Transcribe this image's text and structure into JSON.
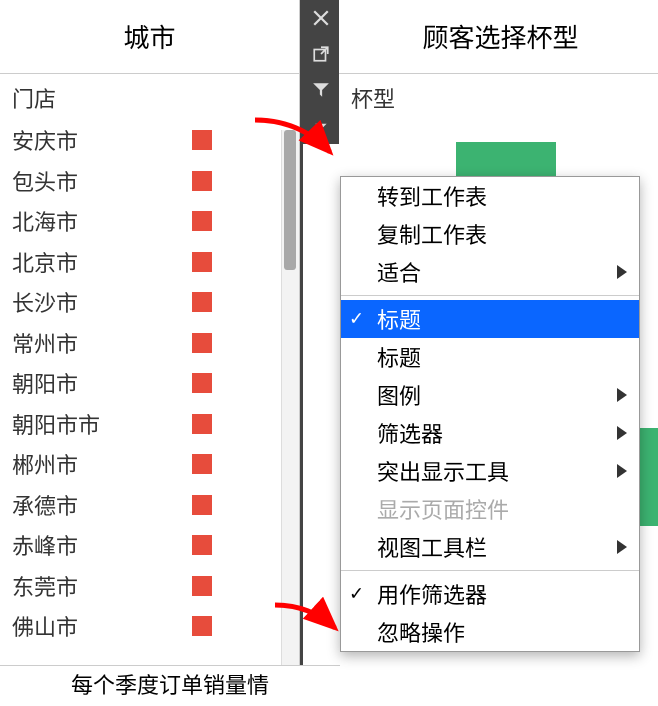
{
  "left": {
    "title": "城市",
    "store_label": "门店",
    "cities": [
      "安庆市",
      "包头市",
      "北海市",
      "北京市",
      "长沙市",
      "常州市",
      "朝阳市",
      "朝阳市市",
      "郴州市",
      "承德市",
      "赤峰市",
      "东莞市",
      "佛山市"
    ],
    "swatch_color": "#e74c3c"
  },
  "toolbar": {
    "close": "close",
    "popout": "popout",
    "filter": "filter",
    "dropdown": "dropdown"
  },
  "right": {
    "title": "顾客选择杯型",
    "sublabel": "杯型"
  },
  "footer": "每个季度订单销量情",
  "menu": {
    "goto_sheet": "转到工作表",
    "copy_sheet": "复制工作表",
    "fit": "适合",
    "title_checked": "标题",
    "title2": "标题",
    "legend": "图例",
    "filters": "筛选器",
    "highlight": "突出显示工具",
    "show_page_ctrl": "显示页面控件",
    "view_toolbar": "视图工具栏",
    "use_as_filter": "用作筛选器",
    "ignore_ops": "忽略操作"
  }
}
